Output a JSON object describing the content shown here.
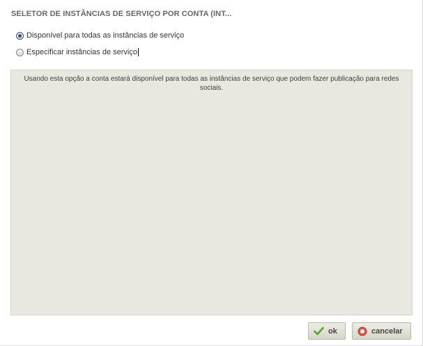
{
  "dialog": {
    "title": "SELETOR DE INSTÂNCIAS DE SERVIÇO POR CONTA (INT..."
  },
  "options": [
    {
      "label": "Disponível para todas as instâncias de serviço",
      "checked": true
    },
    {
      "label": "Especificar instâncias de serviço",
      "checked": false
    }
  ],
  "description": "Usando esta opção a conta estará disponível para todas as instâncias de serviço que podem fazer publicação para redes sociais.",
  "buttons": {
    "ok_label": "ok",
    "cancel_label": "cancelar"
  },
  "icons": {
    "ok": "checkmark-icon",
    "cancel": "cancel-circle-icon"
  },
  "colors": {
    "panel_background": "#e8e8e0",
    "ok_icon": "#5aa02c",
    "cancel_icon": "#d9534f"
  }
}
